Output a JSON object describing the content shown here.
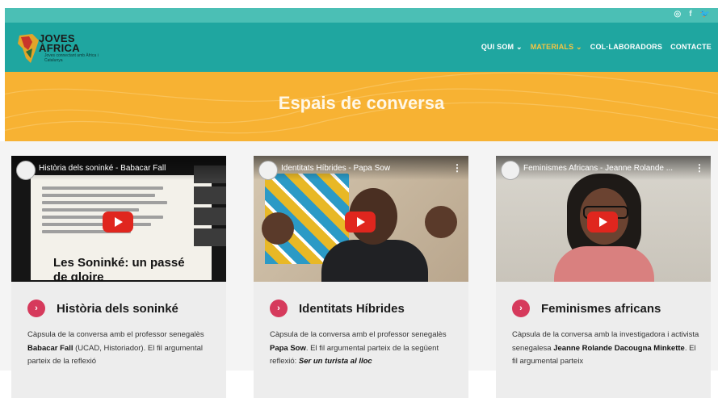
{
  "header": {
    "logo": {
      "title_line1": "JOVES",
      "title_line2": "ÀFRICA",
      "subtitle": "Joves connectant amb Àfrica i Catalunya"
    },
    "nav": [
      {
        "label": "QUI SOM ⌄",
        "active": false
      },
      {
        "label": "MATERIALS ⌄",
        "active": true
      },
      {
        "label": "COL·LABORADORS",
        "active": false
      },
      {
        "label": "CONTACTE",
        "active": false
      }
    ],
    "social": [
      "instagram-icon",
      "facebook-icon",
      "twitter-icon"
    ]
  },
  "hero": {
    "title": "Espais de conversa"
  },
  "cards": [
    {
      "video_title": "Història dels soninké - Babacar Fall",
      "slide_title_line1": "Les Soninké: un passé",
      "slide_title_line2": "de gloire",
      "title": "Història dels soninké",
      "desc_pre": "Càpsula de la conversa amb el professor senegalès ",
      "desc_bold": "Babacar Fall",
      "desc_post": " (UCAD, Historiador). El fil argumental parteix de la reflexió"
    },
    {
      "video_title": "Identitats Híbrides - Papa Sow",
      "title": "Identitats Híbrides",
      "desc_pre": "Càpsula de la conversa amb el professor senegalès ",
      "desc_bold": "Papa Sow",
      "desc_post": ". El fil argumental parteix de la següent reflexió: ",
      "desc_bold2": "Ser un turista al lloc"
    },
    {
      "video_title": "Feminismes Africans - Jeanne Rolande ...",
      "title": "Feminismes africans",
      "desc_pre": "Càpsula de la conversa amb la investigadora i activista senegalesa ",
      "desc_bold": "Jeanne Rolande Dacougna Minkette",
      "desc_post": ". El fil argumental parteix"
    }
  ],
  "colors": {
    "teal": "#1fa6a0",
    "hero": "#f7b233",
    "accent": "#d63a5c",
    "youtube": "#e0261e",
    "nav_active": "#f5c542"
  }
}
